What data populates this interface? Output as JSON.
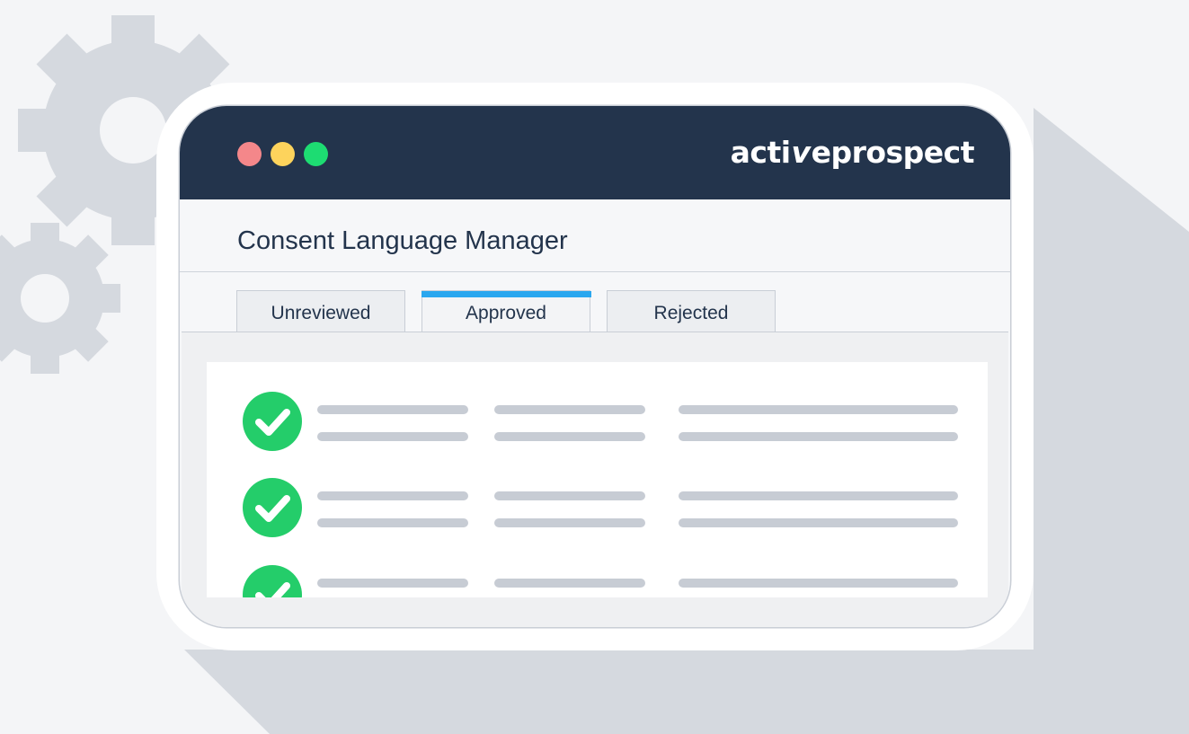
{
  "window": {
    "controls": [
      "close-dot",
      "minimize-dot",
      "maximize-dot"
    ],
    "logo": {
      "prefix": "acti",
      "mark": "v",
      "suffix": "eprospect"
    }
  },
  "page": {
    "title": "Consent Language Manager"
  },
  "tabs": [
    {
      "label": "Unreviewed",
      "active": false
    },
    {
      "label": "Approved",
      "active": true
    },
    {
      "label": "Rejected",
      "active": false
    }
  ],
  "list": {
    "rows": 3,
    "row_icon": "check-circle-icon",
    "placeholder_columns": 3
  },
  "colors": {
    "titlebar": "#23344c",
    "accent": "#2aa7ef",
    "success": "#24cd6a",
    "close": "#f4878a",
    "minimize": "#fdd35c",
    "maximize": "#1ddc72"
  }
}
